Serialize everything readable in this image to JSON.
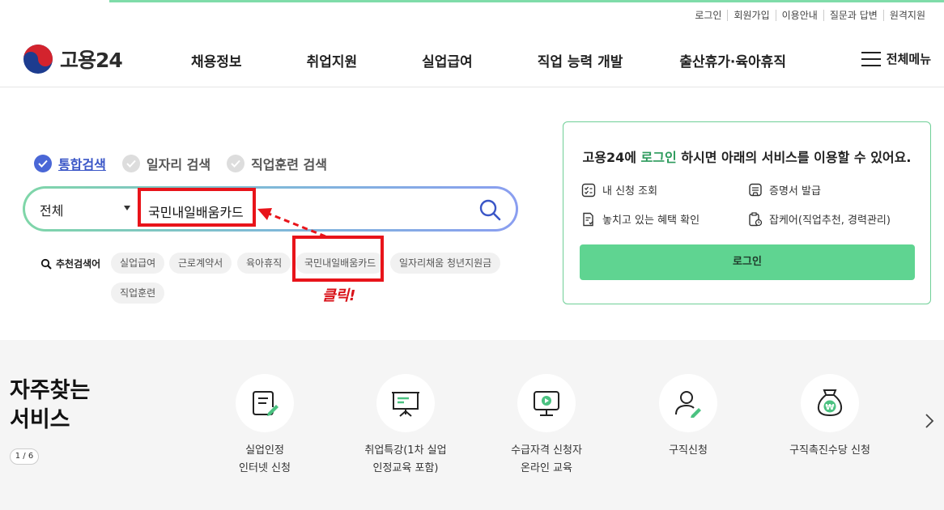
{
  "top_links": [
    "로그인",
    "회원가입",
    "이용안내",
    "질문과 답변",
    "원격지원"
  ],
  "logo": {
    "text": "고용24"
  },
  "gnb": [
    "채용정보",
    "취업지원",
    "실업급여",
    "직업 능력 개발",
    "출산휴가·육아휴직"
  ],
  "all_menu": "전체메뉴",
  "search": {
    "tabs": [
      {
        "label": "통합검색",
        "active": true
      },
      {
        "label": "일자리 검색",
        "active": false
      },
      {
        "label": "직업훈련 검색",
        "active": false
      }
    ],
    "scope": "전체",
    "query": "국민내일배움카드",
    "recommend_label": "추천검색어",
    "chips": [
      "실업급여",
      "근로계약서",
      "육아휴직",
      "국민내일배움카드",
      "일자리채움 청년지원금",
      "직업훈련"
    ]
  },
  "annotation": {
    "click_text": "클릭!"
  },
  "login_box": {
    "title_pre": "고용24에 ",
    "title_highlight": "로그인",
    "title_post": " 하시면 아래의 서비스를 이용할 수 있어요.",
    "items": [
      "내 신청 조회",
      "증명서 발급",
      "놓치고 있는 혜택 확인",
      "잡케어(직업추천, 경력관리)"
    ],
    "button": "로그인"
  },
  "services": {
    "title_line1": "자주찾는",
    "title_line2": "서비스",
    "pager": "1 / 6",
    "items": [
      {
        "line1": "실업인정",
        "line2": "인터넷 신청"
      },
      {
        "line1": "취업특강(1차 실업",
        "line2": "인정교육 포함)"
      },
      {
        "line1": "수급자격 신청자",
        "line2": "온라인 교육"
      },
      {
        "line1": "구직신청",
        "line2": ""
      },
      {
        "line1": "구직촉진수당 신청",
        "line2": ""
      }
    ]
  },
  "colors": {
    "accent_green": "#5fd491",
    "brand_blue": "#4a67d6",
    "annotation_red": "#e8141a"
  }
}
